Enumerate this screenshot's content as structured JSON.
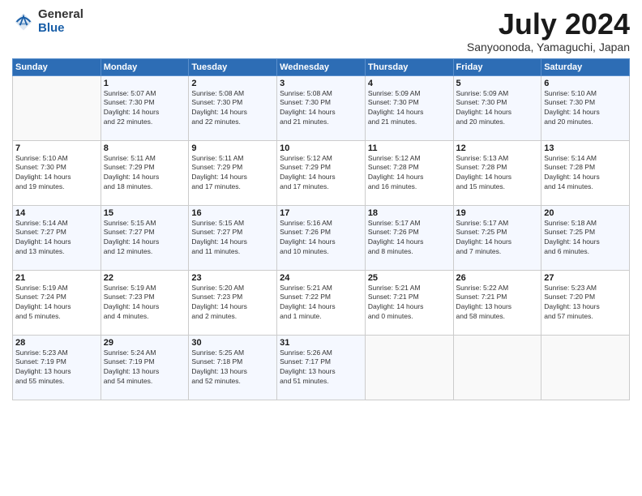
{
  "logo": {
    "general": "General",
    "blue": "Blue"
  },
  "title": "July 2024",
  "subtitle": "Sanyoonoda, Yamaguchi, Japan",
  "weekdays": [
    "Sunday",
    "Monday",
    "Tuesday",
    "Wednesday",
    "Thursday",
    "Friday",
    "Saturday"
  ],
  "weeks": [
    [
      {
        "day": "",
        "info": ""
      },
      {
        "day": "1",
        "info": "Sunrise: 5:07 AM\nSunset: 7:30 PM\nDaylight: 14 hours\nand 22 minutes."
      },
      {
        "day": "2",
        "info": "Sunrise: 5:08 AM\nSunset: 7:30 PM\nDaylight: 14 hours\nand 22 minutes."
      },
      {
        "day": "3",
        "info": "Sunrise: 5:08 AM\nSunset: 7:30 PM\nDaylight: 14 hours\nand 21 minutes."
      },
      {
        "day": "4",
        "info": "Sunrise: 5:09 AM\nSunset: 7:30 PM\nDaylight: 14 hours\nand 21 minutes."
      },
      {
        "day": "5",
        "info": "Sunrise: 5:09 AM\nSunset: 7:30 PM\nDaylight: 14 hours\nand 20 minutes."
      },
      {
        "day": "6",
        "info": "Sunrise: 5:10 AM\nSunset: 7:30 PM\nDaylight: 14 hours\nand 20 minutes."
      }
    ],
    [
      {
        "day": "7",
        "info": "Sunrise: 5:10 AM\nSunset: 7:30 PM\nDaylight: 14 hours\nand 19 minutes."
      },
      {
        "day": "8",
        "info": "Sunrise: 5:11 AM\nSunset: 7:29 PM\nDaylight: 14 hours\nand 18 minutes."
      },
      {
        "day": "9",
        "info": "Sunrise: 5:11 AM\nSunset: 7:29 PM\nDaylight: 14 hours\nand 17 minutes."
      },
      {
        "day": "10",
        "info": "Sunrise: 5:12 AM\nSunset: 7:29 PM\nDaylight: 14 hours\nand 17 minutes."
      },
      {
        "day": "11",
        "info": "Sunrise: 5:12 AM\nSunset: 7:28 PM\nDaylight: 14 hours\nand 16 minutes."
      },
      {
        "day": "12",
        "info": "Sunrise: 5:13 AM\nSunset: 7:28 PM\nDaylight: 14 hours\nand 15 minutes."
      },
      {
        "day": "13",
        "info": "Sunrise: 5:14 AM\nSunset: 7:28 PM\nDaylight: 14 hours\nand 14 minutes."
      }
    ],
    [
      {
        "day": "14",
        "info": "Sunrise: 5:14 AM\nSunset: 7:27 PM\nDaylight: 14 hours\nand 13 minutes."
      },
      {
        "day": "15",
        "info": "Sunrise: 5:15 AM\nSunset: 7:27 PM\nDaylight: 14 hours\nand 12 minutes."
      },
      {
        "day": "16",
        "info": "Sunrise: 5:15 AM\nSunset: 7:27 PM\nDaylight: 14 hours\nand 11 minutes."
      },
      {
        "day": "17",
        "info": "Sunrise: 5:16 AM\nSunset: 7:26 PM\nDaylight: 14 hours\nand 10 minutes."
      },
      {
        "day": "18",
        "info": "Sunrise: 5:17 AM\nSunset: 7:26 PM\nDaylight: 14 hours\nand 8 minutes."
      },
      {
        "day": "19",
        "info": "Sunrise: 5:17 AM\nSunset: 7:25 PM\nDaylight: 14 hours\nand 7 minutes."
      },
      {
        "day": "20",
        "info": "Sunrise: 5:18 AM\nSunset: 7:25 PM\nDaylight: 14 hours\nand 6 minutes."
      }
    ],
    [
      {
        "day": "21",
        "info": "Sunrise: 5:19 AM\nSunset: 7:24 PM\nDaylight: 14 hours\nand 5 minutes."
      },
      {
        "day": "22",
        "info": "Sunrise: 5:19 AM\nSunset: 7:23 PM\nDaylight: 14 hours\nand 4 minutes."
      },
      {
        "day": "23",
        "info": "Sunrise: 5:20 AM\nSunset: 7:23 PM\nDaylight: 14 hours\nand 2 minutes."
      },
      {
        "day": "24",
        "info": "Sunrise: 5:21 AM\nSunset: 7:22 PM\nDaylight: 14 hours\nand 1 minute."
      },
      {
        "day": "25",
        "info": "Sunrise: 5:21 AM\nSunset: 7:21 PM\nDaylight: 14 hours\nand 0 minutes."
      },
      {
        "day": "26",
        "info": "Sunrise: 5:22 AM\nSunset: 7:21 PM\nDaylight: 13 hours\nand 58 minutes."
      },
      {
        "day": "27",
        "info": "Sunrise: 5:23 AM\nSunset: 7:20 PM\nDaylight: 13 hours\nand 57 minutes."
      }
    ],
    [
      {
        "day": "28",
        "info": "Sunrise: 5:23 AM\nSunset: 7:19 PM\nDaylight: 13 hours\nand 55 minutes."
      },
      {
        "day": "29",
        "info": "Sunrise: 5:24 AM\nSunset: 7:19 PM\nDaylight: 13 hours\nand 54 minutes."
      },
      {
        "day": "30",
        "info": "Sunrise: 5:25 AM\nSunset: 7:18 PM\nDaylight: 13 hours\nand 52 minutes."
      },
      {
        "day": "31",
        "info": "Sunrise: 5:26 AM\nSunset: 7:17 PM\nDaylight: 13 hours\nand 51 minutes."
      },
      {
        "day": "",
        "info": ""
      },
      {
        "day": "",
        "info": ""
      },
      {
        "day": "",
        "info": ""
      }
    ]
  ]
}
